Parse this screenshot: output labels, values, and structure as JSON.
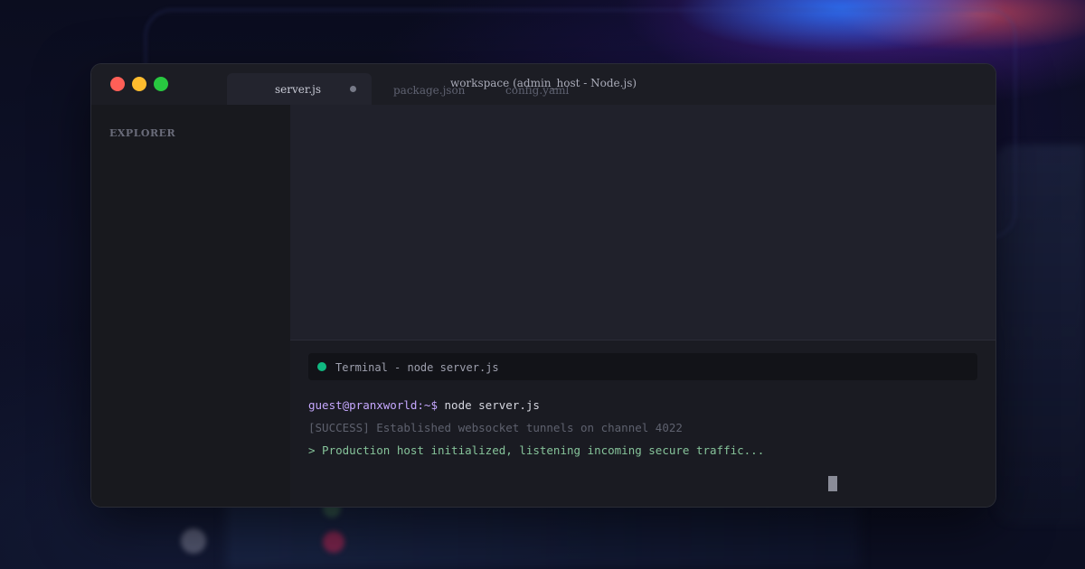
{
  "window": {
    "title": "workspace (admin_host - Node.js)",
    "tabs": [
      {
        "label": "server.js",
        "active": true
      },
      {
        "label": "package.json",
        "active": false
      },
      {
        "label": "config.yaml",
        "active": false
      }
    ]
  },
  "sidebar": {
    "title": "EXPLORER"
  },
  "terminal": {
    "title": "Terminal - node server.js",
    "lines": [
      {
        "prompt": "guest@pranxworld:~$",
        "command": "node server.js"
      },
      {
        "text": "[SUCCESS] Established websocket tunnels on channel 4022"
      },
      {
        "text": "> Production host initialized, listening incoming secure traffic..."
      }
    ]
  },
  "colors": {
    "close": "#ff5f57",
    "minimize": "#febc2e",
    "maximize": "#28c840",
    "terminal_status": "#10b981",
    "success_text": "#86c39a",
    "prompt": "#c6a8ff"
  }
}
